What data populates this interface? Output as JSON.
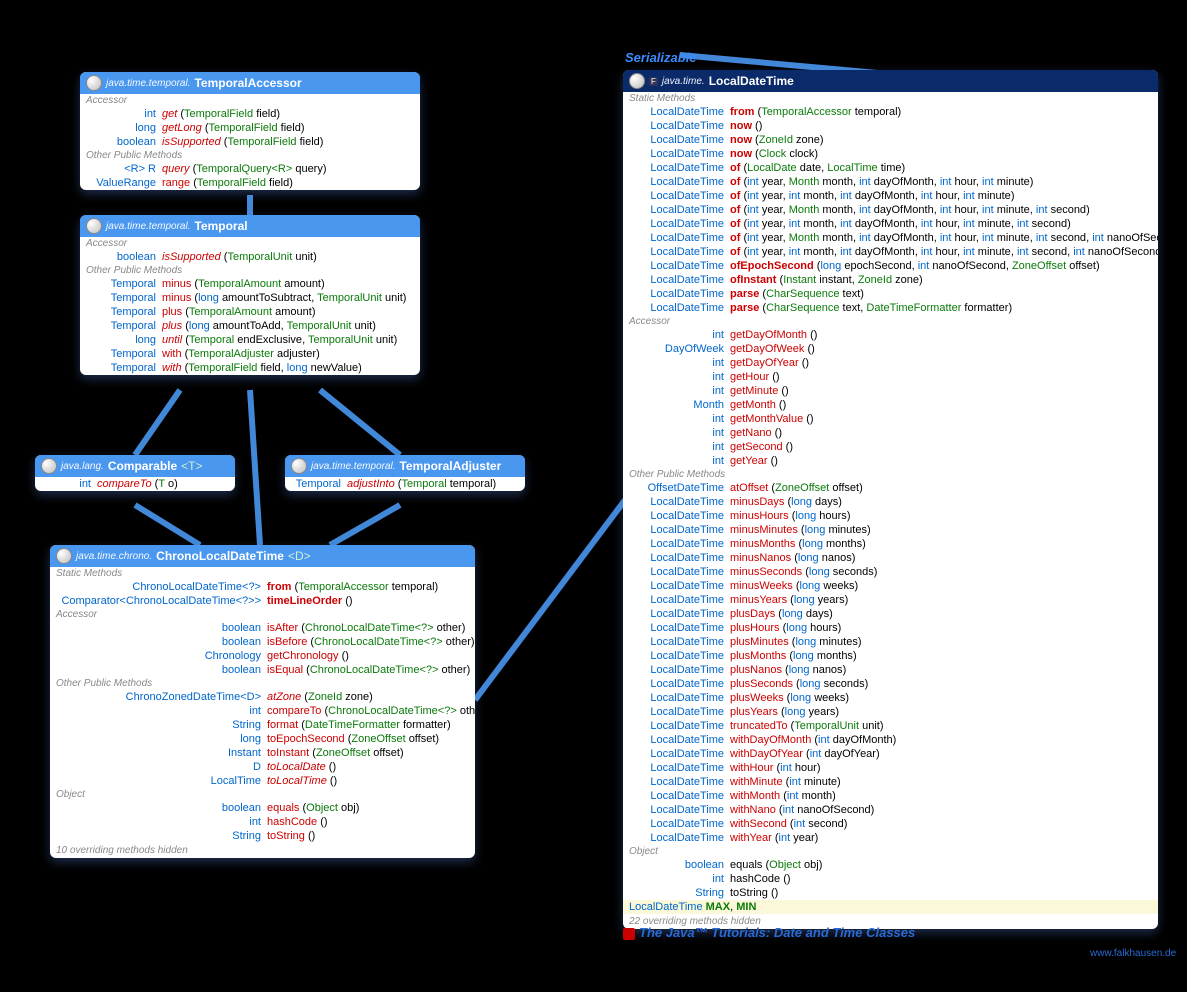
{
  "serializable_label": "Serializable",
  "footer_link": "The Java™ Tutorials: Date and Time Classes",
  "footer_credit": "www.falkhausen.de",
  "boxes": {
    "temporalAccessor": {
      "pkg": "java.time.temporal.",
      "cls": "TemporalAccessor",
      "sections": [
        {
          "label": "Accessor",
          "rows": [
            {
              "ret": "int",
              "name": "get",
              "params": "(TemporalField field)",
              "nred": true
            },
            {
              "ret": "long",
              "name": "getLong",
              "params": "(TemporalField field)",
              "nred": true
            },
            {
              "ret": "boolean",
              "name": "isSupported",
              "params": "(TemporalField field)",
              "nred": true
            }
          ]
        },
        {
          "label": "Other Public Methods",
          "rows": [
            {
              "ret": "<R> R",
              "name": "query",
              "params": "(TemporalQuery<R> query)",
              "nred": true,
              "retType": true
            },
            {
              "ret": "ValueRange",
              "name": "range",
              "params": "(TemporalField field)",
              "retType": true
            }
          ]
        }
      ]
    },
    "temporal": {
      "pkg": "java.time.temporal.",
      "cls": "Temporal",
      "sections": [
        {
          "label": "Accessor",
          "rows": [
            {
              "ret": "boolean",
              "name": "isSupported",
              "params": "(TemporalUnit unit)",
              "nred": true
            }
          ]
        },
        {
          "label": "Other Public Methods",
          "rows": [
            {
              "ret": "Temporal",
              "name": "minus",
              "params": "(TemporalAmount amount)",
              "retType": true
            },
            {
              "ret": "Temporal",
              "name": "minus",
              "params": "(long amountToSubtract, TemporalUnit unit)",
              "retType": true
            },
            {
              "ret": "Temporal",
              "name": "plus",
              "params": "(TemporalAmount amount)",
              "retType": true
            },
            {
              "ret": "Temporal",
              "name": "plus",
              "params": "(long amountToAdd, TemporalUnit unit)",
              "retType": true,
              "nred": true
            },
            {
              "ret": "long",
              "name": "until",
              "params": "(Temporal endExclusive, TemporalUnit unit)",
              "nred": true
            },
            {
              "ret": "Temporal",
              "name": "with",
              "params": "(TemporalAdjuster adjuster)",
              "retType": true
            },
            {
              "ret": "Temporal",
              "name": "with",
              "params": "(TemporalField field, long newValue)",
              "retType": true,
              "nred": true
            }
          ]
        }
      ]
    },
    "comparable": {
      "pkg": "java.lang.",
      "cls": "Comparable",
      "g": "<T>",
      "rows": [
        {
          "ret": "int",
          "name": "compareTo",
          "params": "(T o)",
          "nred": true
        }
      ]
    },
    "temporalAdjuster": {
      "pkg": "java.time.temporal.",
      "cls": "TemporalAdjuster",
      "rows": [
        {
          "ret": "Temporal",
          "name": "adjustInto",
          "params": "(Temporal temporal)",
          "retType": true,
          "nred": true
        }
      ]
    },
    "chrono": {
      "pkg": "java.time.chrono.",
      "cls": "ChronoLocalDateTime",
      "g": "<D>",
      "sections": [
        {
          "label": "Static Methods",
          "rows": [
            {
              "ret": "ChronoLocalDateTime<?>",
              "name": "from",
              "params": "(TemporalAccessor temporal)",
              "retType": true,
              "bold": true
            },
            {
              "ret": "Comparator<ChronoLocalDateTime<?>>",
              "name": "timeLineOrder",
              "params": "()",
              "retType": true,
              "bold": true
            }
          ]
        },
        {
          "label": "Accessor",
          "rows": [
            {
              "ret": "boolean",
              "name": "isAfter",
              "params": "(ChronoLocalDateTime<?> other)"
            },
            {
              "ret": "boolean",
              "name": "isBefore",
              "params": "(ChronoLocalDateTime<?> other)"
            },
            {
              "ret": "Chronology",
              "name": "getChronology",
              "params": "()",
              "retType": true
            },
            {
              "ret": "boolean",
              "name": "isEqual",
              "params": "(ChronoLocalDateTime<?> other)"
            }
          ]
        },
        {
          "label": "Other Public Methods",
          "rows": [
            {
              "ret": "ChronoZonedDateTime<D>",
              "name": "atZone",
              "params": "(ZoneId zone)",
              "retType": true,
              "nred": true
            },
            {
              "ret": "int",
              "name": "compareTo",
              "params": "(ChronoLocalDateTime<?> other)"
            },
            {
              "ret": "String",
              "name": "format",
              "params": "(DateTimeFormatter formatter)",
              "retType": true
            },
            {
              "ret": "long",
              "name": "toEpochSecond",
              "params": "(ZoneOffset offset)"
            },
            {
              "ret": "Instant",
              "name": "toInstant",
              "params": "(ZoneOffset offset)",
              "retType": true
            },
            {
              "ret": "D",
              "name": "toLocalDate",
              "params": "()",
              "retType": true,
              "nred": true
            },
            {
              "ret": "LocalTime",
              "name": "toLocalTime",
              "params": "()",
              "retType": true,
              "nred": true
            }
          ]
        },
        {
          "label": "Object",
          "rows": [
            {
              "ret": "boolean",
              "name": "equals",
              "params": "(Object obj)"
            },
            {
              "ret": "int",
              "name": "hashCode",
              "params": "()"
            },
            {
              "ret": "String",
              "name": "toString",
              "params": "()",
              "retType": true
            }
          ]
        }
      ],
      "note": "10 overriding methods hidden"
    },
    "localDateTime": {
      "pkg": "java.time.",
      "cls": "LocalDateTime",
      "badge": "F",
      "sections": [
        {
          "label": "Static Methods",
          "retw": 95,
          "rows": [
            {
              "ret": "LocalDateTime",
              "name": "from",
              "params": "(TemporalAccessor temporal)",
              "retType": true,
              "bold": true
            },
            {
              "ret": "LocalDateTime",
              "name": "now",
              "params": "()",
              "retType": true,
              "bold": true
            },
            {
              "ret": "LocalDateTime",
              "name": "now",
              "params": "(ZoneId zone)",
              "retType": true,
              "bold": true
            },
            {
              "ret": "LocalDateTime",
              "name": "now",
              "params": "(Clock clock)",
              "retType": true,
              "bold": true
            },
            {
              "ret": "LocalDateTime",
              "name": "of",
              "params": "(LocalDate date, LocalTime time)",
              "retType": true,
              "bold": true
            },
            {
              "ret": "LocalDateTime",
              "name": "of",
              "params": "(int year, Month month, int dayOfMonth, int hour, int minute)",
              "retType": true,
              "bold": true
            },
            {
              "ret": "LocalDateTime",
              "name": "of",
              "params": "(int year, int month, int dayOfMonth, int hour, int minute)",
              "retType": true,
              "bold": true
            },
            {
              "ret": "LocalDateTime",
              "name": "of",
              "params": "(int year, Month month, int dayOfMonth, int hour, int minute, int second)",
              "retType": true,
              "bold": true
            },
            {
              "ret": "LocalDateTime",
              "name": "of",
              "params": "(int year, int month, int dayOfMonth, int hour, int minute, int second)",
              "retType": true,
              "bold": true
            },
            {
              "ret": "LocalDateTime",
              "name": "of",
              "params": "(int year, Month month, int dayOfMonth, int hour, int minute, int second, int nanoOfSecond)",
              "retType": true,
              "bold": true
            },
            {
              "ret": "LocalDateTime",
              "name": "of",
              "params": "(int year, int month, int dayOfMonth, int hour, int minute, int second, int nanoOfSecond)",
              "retType": true,
              "bold": true
            },
            {
              "ret": "LocalDateTime",
              "name": "ofEpochSecond",
              "params": "(long epochSecond, int nanoOfSecond, ZoneOffset offset)",
              "retType": true,
              "bold": true
            },
            {
              "ret": "LocalDateTime",
              "name": "ofInstant",
              "params": "(Instant instant, ZoneId zone)",
              "retType": true,
              "bold": true
            },
            {
              "ret": "LocalDateTime",
              "name": "parse",
              "params": "(CharSequence text)",
              "retType": true,
              "bold": true
            },
            {
              "ret": "LocalDateTime",
              "name": "parse",
              "params": "(CharSequence text, DateTimeFormatter formatter)",
              "retType": true,
              "bold": true
            }
          ]
        },
        {
          "label": "Accessor",
          "retw": 95,
          "rows": [
            {
              "ret": "int",
              "name": "getDayOfMonth",
              "params": "()"
            },
            {
              "ret": "DayOfWeek",
              "name": "getDayOfWeek",
              "params": "()",
              "retType": true
            },
            {
              "ret": "int",
              "name": "getDayOfYear",
              "params": "()"
            },
            {
              "ret": "int",
              "name": "getHour",
              "params": "()"
            },
            {
              "ret": "int",
              "name": "getMinute",
              "params": "()"
            },
            {
              "ret": "Month",
              "name": "getMonth",
              "params": "()",
              "retType": true
            },
            {
              "ret": "int",
              "name": "getMonthValue",
              "params": "()"
            },
            {
              "ret": "int",
              "name": "getNano",
              "params": "()"
            },
            {
              "ret": "int",
              "name": "getSecond",
              "params": "()"
            },
            {
              "ret": "int",
              "name": "getYear",
              "params": "()"
            }
          ]
        },
        {
          "label": "Other Public Methods",
          "retw": 95,
          "rows": [
            {
              "ret": "OffsetDateTime",
              "name": "atOffset",
              "params": "(ZoneOffset offset)",
              "retType": true
            },
            {
              "ret": "LocalDateTime",
              "name": "minusDays",
              "params": "(long days)",
              "retType": true
            },
            {
              "ret": "LocalDateTime",
              "name": "minusHours",
              "params": "(long hours)",
              "retType": true
            },
            {
              "ret": "LocalDateTime",
              "name": "minusMinutes",
              "params": "(long minutes)",
              "retType": true
            },
            {
              "ret": "LocalDateTime",
              "name": "minusMonths",
              "params": "(long months)",
              "retType": true
            },
            {
              "ret": "LocalDateTime",
              "name": "minusNanos",
              "params": "(long nanos)",
              "retType": true
            },
            {
              "ret": "LocalDateTime",
              "name": "minusSeconds",
              "params": "(long seconds)",
              "retType": true
            },
            {
              "ret": "LocalDateTime",
              "name": "minusWeeks",
              "params": "(long weeks)",
              "retType": true
            },
            {
              "ret": "LocalDateTime",
              "name": "minusYears",
              "params": "(long years)",
              "retType": true
            },
            {
              "ret": "LocalDateTime",
              "name": "plusDays",
              "params": "(long days)",
              "retType": true
            },
            {
              "ret": "LocalDateTime",
              "name": "plusHours",
              "params": "(long hours)",
              "retType": true
            },
            {
              "ret": "LocalDateTime",
              "name": "plusMinutes",
              "params": "(long minutes)",
              "retType": true
            },
            {
              "ret": "LocalDateTime",
              "name": "plusMonths",
              "params": "(long months)",
              "retType": true
            },
            {
              "ret": "LocalDateTime",
              "name": "plusNanos",
              "params": "(long nanos)",
              "retType": true
            },
            {
              "ret": "LocalDateTime",
              "name": "plusSeconds",
              "params": "(long seconds)",
              "retType": true
            },
            {
              "ret": "LocalDateTime",
              "name": "plusWeeks",
              "params": "(long weeks)",
              "retType": true
            },
            {
              "ret": "LocalDateTime",
              "name": "plusYears",
              "params": "(long years)",
              "retType": true
            },
            {
              "ret": "LocalDateTime",
              "name": "truncatedTo",
              "params": "(TemporalUnit unit)",
              "retType": true
            },
            {
              "ret": "LocalDateTime",
              "name": "withDayOfMonth",
              "params": "(int dayOfMonth)",
              "retType": true
            },
            {
              "ret": "LocalDateTime",
              "name": "withDayOfYear",
              "params": "(int dayOfYear)",
              "retType": true
            },
            {
              "ret": "LocalDateTime",
              "name": "withHour",
              "params": "(int hour)",
              "retType": true
            },
            {
              "ret": "LocalDateTime",
              "name": "withMinute",
              "params": "(int minute)",
              "retType": true
            },
            {
              "ret": "LocalDateTime",
              "name": "withMonth",
              "params": "(int month)",
              "retType": true
            },
            {
              "ret": "LocalDateTime",
              "name": "withNano",
              "params": "(int nanoOfSecond)",
              "retType": true
            },
            {
              "ret": "LocalDateTime",
              "name": "withSecond",
              "params": "(int second)",
              "retType": true
            },
            {
              "ret": "LocalDateTime",
              "name": "withYear",
              "params": "(int year)",
              "retType": true
            }
          ]
        },
        {
          "label": "Object",
          "retw": 95,
          "rows": [
            {
              "ret": "boolean",
              "name": "equals",
              "params": "(Object obj)",
              "nblack": true
            },
            {
              "ret": "int",
              "name": "hashCode",
              "params": "()",
              "nblack": true
            },
            {
              "ret": "String",
              "name": "toString",
              "params": "()",
              "retType": true,
              "nblack": true
            }
          ]
        }
      ],
      "fields": "LocalDateTime MAX, MIN",
      "note": "22 overriding methods hidden"
    }
  }
}
